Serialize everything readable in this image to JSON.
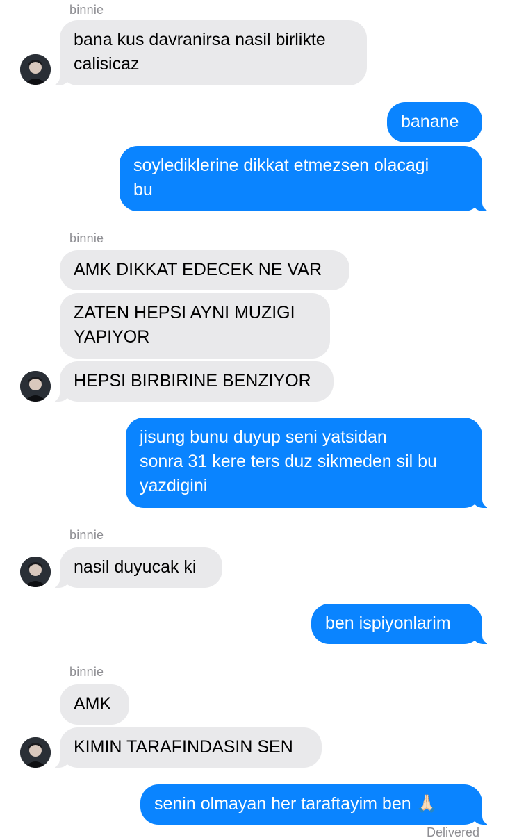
{
  "contact": {
    "name": "binnie"
  },
  "messages": [
    {
      "dir": "in",
      "text": "bana kus davranirsa nasil birlikte\ncalisicaz"
    },
    {
      "dir": "out",
      "text": "banane"
    },
    {
      "dir": "out",
      "text": "soylediklerine dikkat etmezsen olacagi\nbu"
    },
    {
      "dir": "in",
      "text": "AMK DIKKAT EDECEK NE VAR"
    },
    {
      "dir": "in",
      "text": "ZATEN HEPSI AYNI MUZIGI\nYAPIYOR"
    },
    {
      "dir": "in",
      "text": "HEPSI BIRBIRINE BENZIYOR"
    },
    {
      "dir": "out",
      "text": "jisung bunu duyup seni yatsidan\nsonra 31 kere ters duz sikmeden sil bu\nyazdigini"
    },
    {
      "dir": "in",
      "text": "nasil duyucak ki"
    },
    {
      "dir": "out",
      "text": "ben ispiyonlarim"
    },
    {
      "dir": "in",
      "text": "AMK"
    },
    {
      "dir": "in",
      "text": "KIMIN TARAFINDASIN SEN"
    },
    {
      "dir": "out",
      "text": "senin olmayan her taraftayim ben 🙏🏻"
    }
  ],
  "status": {
    "delivered": "Delivered"
  },
  "colors": {
    "incoming_bubble": "#e9e9eb",
    "outgoing_bubble": "#0a84ff",
    "meta_text": "#8e8e93"
  },
  "icons": {
    "avatar": "contact-avatar-photo"
  }
}
